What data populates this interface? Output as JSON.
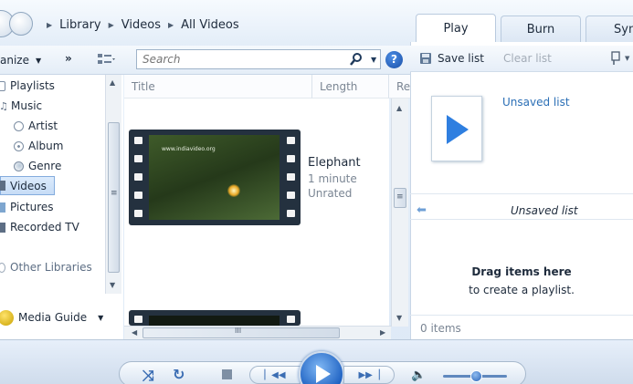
{
  "breadcrumb": {
    "items": [
      "Library",
      "Videos",
      "All Videos"
    ]
  },
  "tabs": [
    {
      "label": "Play"
    },
    {
      "label": "Burn"
    },
    {
      "label": "Syn"
    }
  ],
  "toolbar": {
    "organize_label": "anize",
    "more_label": "»"
  },
  "search": {
    "placeholder": "Search"
  },
  "nav": {
    "items": [
      {
        "label": "Playlists"
      },
      {
        "label": "Music"
      },
      {
        "label": "Artist"
      },
      {
        "label": "Album"
      },
      {
        "label": "Genre"
      },
      {
        "label": "Videos"
      },
      {
        "label": "Pictures"
      },
      {
        "label": "Recorded TV"
      },
      {
        "label": "Other Libraries"
      }
    ],
    "media_guide_label": "Media Guide"
  },
  "columns": [
    {
      "label": "Title"
    },
    {
      "label": "Length"
    },
    {
      "label": "Re"
    }
  ],
  "videos": [
    {
      "title": "Elephant",
      "length": "1 minute",
      "rating": "Unrated",
      "thumbnail_text": "www.indiavideo.org"
    }
  ],
  "list_pane": {
    "save_list_label": "Save list",
    "clear_list_label": "Clear list",
    "unsaved_list_title": "Unsaved list",
    "unsaved_list_subtitle": "Unsaved list",
    "drag_title": "Drag items here",
    "drag_subtitle": "to create a playlist.",
    "item_count": "0 items"
  },
  "scroll_labels": {
    "hscroll_grip": "III",
    "vscroll_grip": "≡"
  },
  "colors": {
    "accent": "#1f62c2",
    "link": "#2b6fb6",
    "selection": "#c6dcf6",
    "text": "#1e2b3c"
  }
}
